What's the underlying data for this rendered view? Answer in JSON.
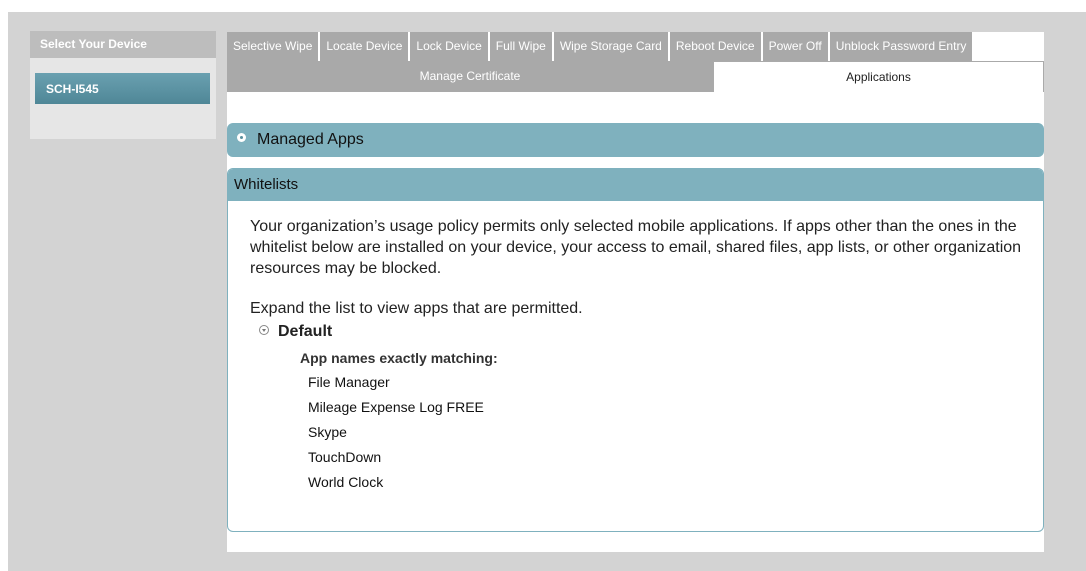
{
  "device_panel": {
    "header": "Select Your Device",
    "devices": [
      "SCH-I545"
    ]
  },
  "tabs": {
    "row1": [
      "Selective Wipe",
      "Locate Device",
      "Lock Device",
      "Full Wipe",
      "Wipe Storage Card",
      "Reboot Device",
      "Power Off",
      "Unblock Password Entry"
    ],
    "row2": [
      {
        "label": "Manage Certificate",
        "active": false
      },
      {
        "label": "Applications",
        "active": true
      }
    ]
  },
  "managed_apps": {
    "title": "Managed Apps"
  },
  "whitelists": {
    "title": "Whitelists",
    "policy_text": "Your organization’s usage policy permits only selected mobile applications. If apps other than the ones in the whitelist below are installed on your device, your access to email, shared files, app lists, or other organization resources may be blocked.",
    "expand_text": "Expand the list to view apps that are permitted.",
    "group": {
      "name": "Default",
      "match_label": "App names exactly matching:",
      "apps": [
        "File Manager",
        "Mileage Expense Log FREE",
        "Skype",
        "TouchDown",
        "World Clock"
      ]
    }
  },
  "colors": {
    "accent": "#7fb1be",
    "tab_inactive": "#a9a9a9",
    "device_selected": "#5a90a0",
    "background": "#d3d3d3"
  }
}
